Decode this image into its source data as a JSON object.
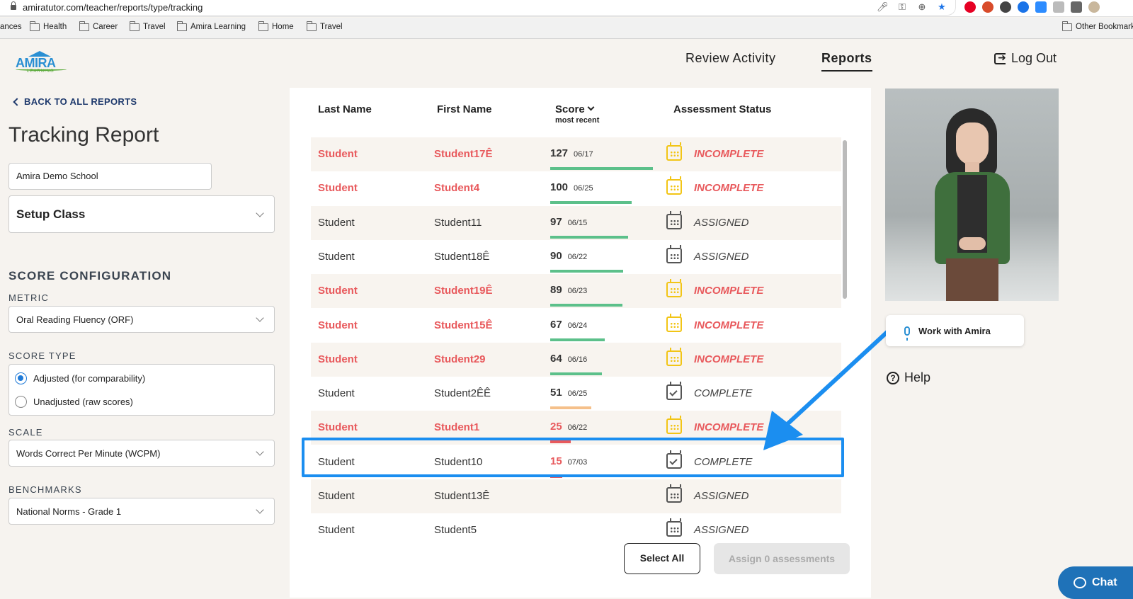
{
  "browser": {
    "url": "amiratutor.com/teacher/reports/type/tracking",
    "bookmarks": [
      "ances",
      "Health",
      "Career",
      "Travel",
      "Amira Learning",
      "Home",
      "Travel"
    ],
    "other_bookmarks": "Other Bookmarks"
  },
  "header": {
    "logo_text": "AMIRA",
    "logo_sub": "LEARNING",
    "nav_review": "Review Activity",
    "nav_reports": "Reports",
    "logout": "Log Out"
  },
  "left": {
    "back_label": "BACK TO ALL REPORTS",
    "title": "Tracking Report",
    "school": "Amira Demo School",
    "setup_class": "Setup Class",
    "score_config_title": "SCORE CONFIGURATION",
    "metric_label": "METRIC",
    "metric_value": "Oral Reading Fluency (ORF)",
    "score_type_label": "SCORE TYPE",
    "score_type_options": [
      "Adjusted (for comparability)",
      "Unadjusted (raw scores)"
    ],
    "score_type_selected": "Adjusted (for comparability)",
    "scale_label": "SCALE",
    "scale_value": "Words Correct Per Minute (WCPM)",
    "benchmarks_label": "BENCHMARKS",
    "benchmarks_value": "National Norms - Grade 1"
  },
  "table": {
    "headers": {
      "last_name": "Last Name",
      "first_name": "First Name",
      "score": "Score",
      "score_sub": "most recent",
      "status": "Assessment Status"
    },
    "rows": [
      {
        "last": "Student",
        "first": "Student17Ê",
        "score": "127",
        "date": "06/17",
        "bar": 1.0,
        "bar_color": "#5cc08a",
        "status": "INCOMPLETE",
        "incomplete": true,
        "icon": "calendar-icon"
      },
      {
        "last": "Student",
        "first": "Student4",
        "score": "100",
        "date": "06/25",
        "bar": 0.79,
        "bar_color": "#5cc08a",
        "status": "INCOMPLETE",
        "incomplete": true,
        "icon": "calendar-icon"
      },
      {
        "last": "Student",
        "first": "Student11",
        "score": "97",
        "date": "06/15",
        "bar": 0.76,
        "bar_color": "#5cc08a",
        "status": "ASSIGNED",
        "incomplete": false,
        "icon": "calendar-icon"
      },
      {
        "last": "Student",
        "first": "Student18Ê",
        "score": "90",
        "date": "06/22",
        "bar": 0.71,
        "bar_color": "#5cc08a",
        "status": "ASSIGNED",
        "incomplete": false,
        "icon": "calendar-icon"
      },
      {
        "last": "Student",
        "first": "Student19Ê",
        "score": "89",
        "date": "06/23",
        "bar": 0.7,
        "bar_color": "#5cc08a",
        "status": "INCOMPLETE",
        "incomplete": true,
        "icon": "calendar-icon"
      },
      {
        "last": "Student",
        "first": "Student15Ê",
        "score": "67",
        "date": "06/24",
        "bar": 0.53,
        "bar_color": "#5cc08a",
        "status": "INCOMPLETE",
        "incomplete": true,
        "icon": "calendar-icon"
      },
      {
        "last": "Student",
        "first": "Student29",
        "score": "64",
        "date": "06/16",
        "bar": 0.5,
        "bar_color": "#5cc08a",
        "status": "INCOMPLETE",
        "incomplete": true,
        "icon": "calendar-icon"
      },
      {
        "last": "Student",
        "first": "Student2ÊÊ",
        "score": "51",
        "date": "06/25",
        "bar": 0.4,
        "bar_color": "#f5c08a",
        "status": "COMPLETE",
        "incomplete": false,
        "icon": "calendar-check-icon"
      },
      {
        "last": "Student",
        "first": "Student1",
        "score": "25",
        "date": "06/22",
        "bar": 0.2,
        "bar_color": "#e8595c",
        "status": "INCOMPLETE",
        "incomplete": true,
        "icon": "calendar-icon",
        "score_red": true
      },
      {
        "last": "Student",
        "first": "Student10",
        "score": "15",
        "date": "07/03",
        "bar": 0.12,
        "bar_color": "#e8595c",
        "status": "COMPLETE",
        "incomplete": false,
        "icon": "calendar-check-icon",
        "score_red": true
      },
      {
        "last": "Student",
        "first": "Student13Ê",
        "score": "",
        "date": "",
        "bar": 0,
        "bar_color": "#5cc08a",
        "status": "ASSIGNED",
        "incomplete": false,
        "icon": "calendar-icon"
      },
      {
        "last": "Student",
        "first": "Student5",
        "score": "",
        "date": "",
        "bar": 0,
        "bar_color": "#5cc08a",
        "status": "ASSIGNED",
        "incomplete": false,
        "icon": "calendar-icon"
      }
    ],
    "select_all": "Select All",
    "assign_button": "Assign 0 assessments"
  },
  "right": {
    "work_with": "Work with Amira",
    "help": "Help"
  },
  "chat": {
    "label": "Chat"
  },
  "colors": {
    "incomplete": "#e8595c",
    "highlight": "#1b8ef0",
    "accent": "#2a8fd3"
  }
}
